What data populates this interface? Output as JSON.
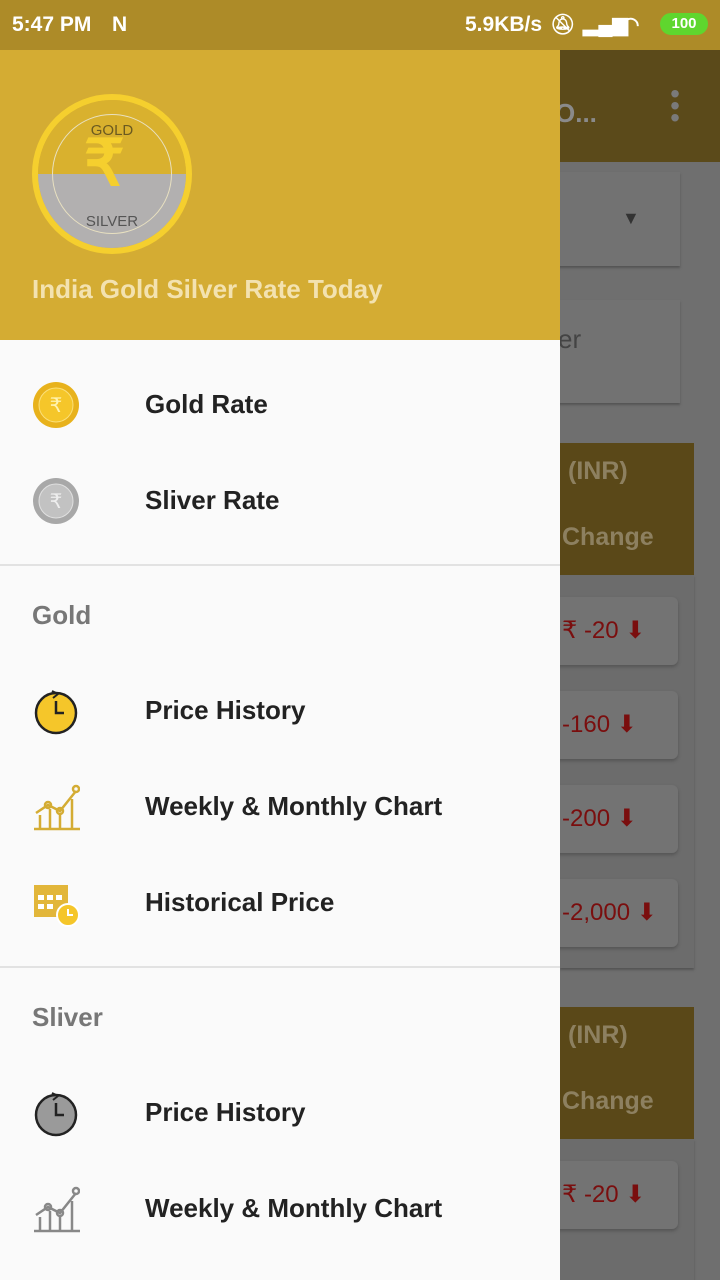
{
  "status_bar": {
    "time": "5:47 PM",
    "notification_icon": "N",
    "net_speed": "5.9KB/s",
    "battery": "100"
  },
  "background": {
    "title_partial": "O...",
    "field_partial": "er",
    "table_headers": [
      {
        "currency": "(INR)",
        "change": "Change"
      },
      {
        "currency": "(INR)",
        "change": "Change"
      }
    ],
    "changes": [
      "₹ -20",
      "-160",
      "-200",
      "-2,000",
      "₹ -20"
    ],
    "down_color": "#7a0e0e"
  },
  "drawer": {
    "header_color": "#d4ac33",
    "logo": {
      "gold": "GOLD",
      "silver": "SILVER"
    },
    "app_title": "India Gold Silver Rate Today",
    "top_items": [
      {
        "label": "Gold Rate",
        "icon": "gold-coin-icon"
      },
      {
        "label": "Sliver Rate",
        "icon": "silver-coin-icon"
      }
    ],
    "sections": [
      {
        "title": "Gold",
        "items": [
          {
            "label": "Price History",
            "icon": "clock-history-icon"
          },
          {
            "label": "Weekly & Monthly Chart",
            "icon": "line-chart-icon"
          },
          {
            "label": "Historical Price",
            "icon": "calendar-clock-icon"
          }
        ]
      },
      {
        "title": "Sliver",
        "items": [
          {
            "label": "Price History",
            "icon": "clock-history-icon"
          },
          {
            "label": "Weekly & Monthly Chart",
            "icon": "line-chart-icon"
          }
        ]
      }
    ]
  }
}
